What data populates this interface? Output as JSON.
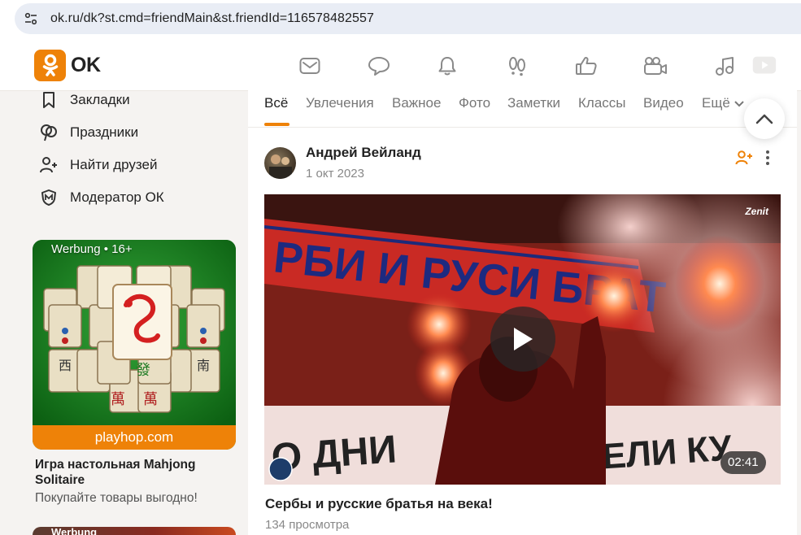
{
  "browser": {
    "url": "ok.ru/dk?st.cmd=friendMain&st.friendId=116578482557"
  },
  "header": {
    "logo_text": "OK",
    "icons": [
      "mail-icon",
      "chat-icon",
      "bell-icon",
      "guests-icon",
      "like-icon",
      "video-camera-icon",
      "music-icon",
      "video-play-icon"
    ]
  },
  "sidebar": {
    "items": [
      {
        "label": "Закладки",
        "icon": "bookmark-icon"
      },
      {
        "label": "Праздники",
        "icon": "balloons-icon"
      },
      {
        "label": "Найти друзей",
        "icon": "add-user-icon"
      },
      {
        "label": "Модератор ОК",
        "icon": "moderator-shield-icon"
      }
    ],
    "ad": {
      "label": "Werbung • 16+",
      "domain": "playhop.com",
      "title": "Игра настольная Mahjong Solitaire",
      "subtitle": "Покупайте товары выгодно!"
    },
    "ad2": {
      "label": "Werbung"
    }
  },
  "feed": {
    "tabs": [
      "Всё",
      "Увлечения",
      "Важное",
      "Фото",
      "Заметки",
      "Классы",
      "Видео",
      "Ещё"
    ],
    "active_tab": "Всё",
    "post": {
      "author": "Андрей Вейланд",
      "date": "1 окт 2023",
      "video": {
        "banner_text": "РБИ И РУСИ БРАТ",
        "duration": "02:41",
        "title": "Сербы и русские братья на века!",
        "views": "134 просмотра"
      }
    }
  },
  "colors": {
    "brand": "#ee8208",
    "background": "#f5f3f1"
  }
}
